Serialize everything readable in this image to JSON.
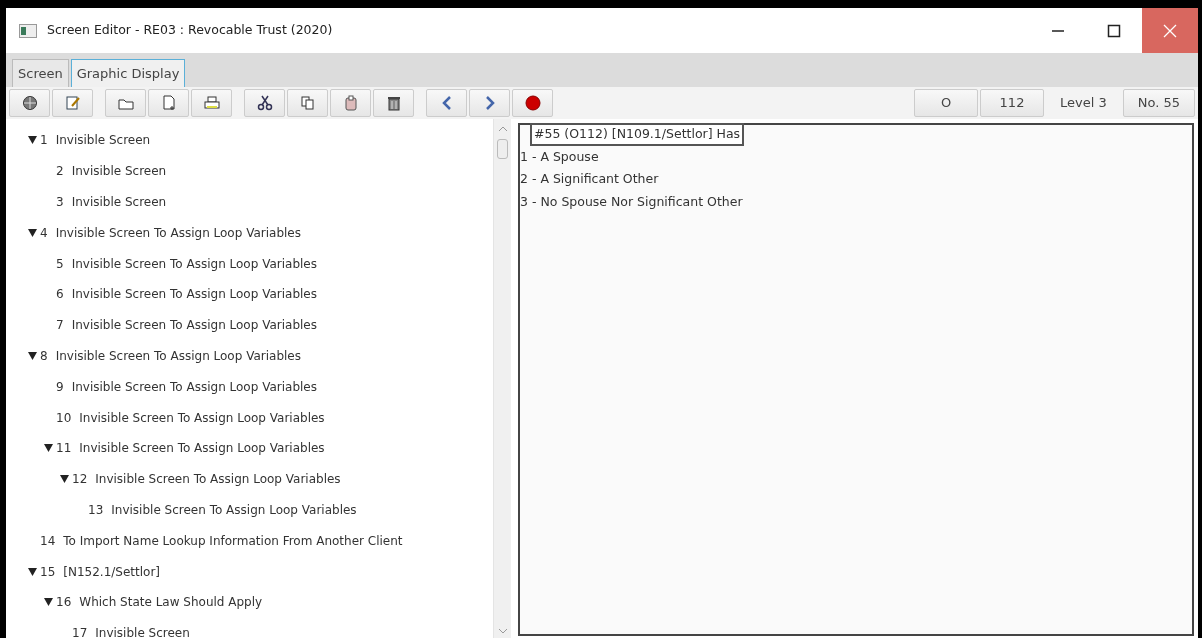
{
  "window": {
    "title": "Screen Editor - RE03 : Revocable Trust (2020)"
  },
  "tabs": [
    {
      "label": "Screen",
      "selected": false
    },
    {
      "label": "Graphic Display",
      "selected": true
    }
  ],
  "toolbar": {
    "status": [
      {
        "kind": "button",
        "text": "O"
      },
      {
        "kind": "button",
        "text": "112"
      },
      {
        "kind": "label",
        "text": "Level 3"
      },
      {
        "kind": "button",
        "text": "No. 55"
      }
    ]
  },
  "tree": [
    {
      "number": "1",
      "label": "Invisible Screen",
      "expanded": true,
      "children": [
        {
          "number": "2",
          "label": "Invisible Screen"
        },
        {
          "number": "3",
          "label": "Invisible Screen"
        }
      ]
    },
    {
      "number": "4",
      "label": "Invisible Screen To Assign Loop Variables",
      "expanded": true,
      "children": [
        {
          "number": "5",
          "label": "Invisible Screen To Assign Loop Variables"
        },
        {
          "number": "6",
          "label": "Invisible Screen To Assign Loop Variables"
        },
        {
          "number": "7",
          "label": "Invisible Screen To Assign Loop Variables"
        }
      ]
    },
    {
      "number": "8",
      "label": "Invisible Screen To Assign Loop Variables",
      "expanded": true,
      "children": [
        {
          "number": "9",
          "label": "Invisible Screen To Assign Loop Variables"
        },
        {
          "number": "10",
          "label": "Invisible Screen To Assign Loop Variables"
        },
        {
          "number": "11",
          "label": "Invisible Screen To Assign Loop Variables",
          "expanded": true,
          "children": [
            {
              "number": "12",
              "label": "Invisible Screen To Assign Loop Variables",
              "expanded": true,
              "children": [
                {
                  "number": "13",
                  "label": "Invisible Screen To Assign Loop Variables"
                }
              ]
            }
          ]
        }
      ]
    },
    {
      "number": "14",
      "label": "To Import Name Lookup Information From Another Client"
    },
    {
      "number": "15",
      "label": "[N152.1/Settlor]",
      "expanded": true,
      "children": [
        {
          "number": "16",
          "label": "Which State Law Should Apply",
          "expanded": true,
          "children": [
            {
              "number": "17",
              "label": "Invisible Screen"
            }
          ]
        }
      ]
    }
  ],
  "display": {
    "header": "#55 (O112) [N109.1/Settlor] Has",
    "options": [
      "1 - A Spouse",
      "2 - A Significant Other",
      "3 - No Spouse Nor Significant Other"
    ]
  }
}
